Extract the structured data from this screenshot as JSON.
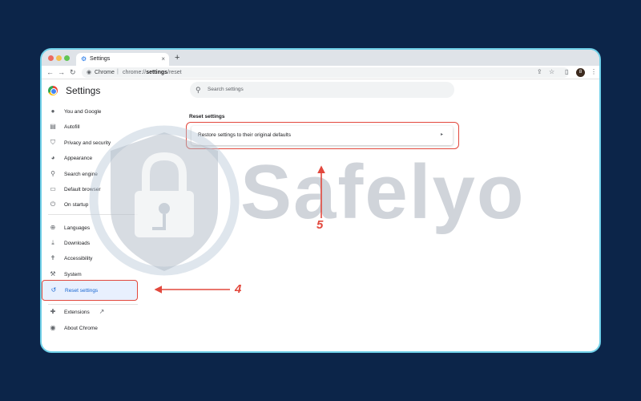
{
  "browser": {
    "tab_title": "Settings",
    "tab_close": "×",
    "new_tab": "+",
    "omnibox": {
      "brand": "Chrome",
      "separator": "|",
      "url_prefix": "chrome://",
      "url_bold": "settings",
      "url_suffix": "/reset"
    },
    "nav": {
      "back": "←",
      "forward": "→",
      "reload": "↻"
    },
    "toolbar_icons": {
      "share": "⇪",
      "bookmark": "☆",
      "side_panel": "▯",
      "menu": "⋮"
    },
    "profile_initial": "8"
  },
  "settings": {
    "title": "Settings",
    "search_placeholder": "Search settings",
    "sidebar": {
      "items": [
        {
          "label": "You and Google",
          "icon": "person-icon",
          "glyph": "●"
        },
        {
          "label": "Autofill",
          "icon": "clipboard-icon",
          "glyph": "▤"
        },
        {
          "label": "Privacy and security",
          "icon": "shield-icon",
          "glyph": "⛉"
        },
        {
          "label": "Appearance",
          "icon": "palette-icon",
          "glyph": "◕"
        },
        {
          "label": "Search engine",
          "icon": "search-icon",
          "glyph": "⚲"
        },
        {
          "label": "Default browser",
          "icon": "browser-icon",
          "glyph": "▭"
        },
        {
          "label": "On startup",
          "icon": "power-icon",
          "glyph": "⏻"
        },
        {
          "label": "Languages",
          "icon": "globe-icon",
          "glyph": "⊕"
        },
        {
          "label": "Downloads",
          "icon": "download-icon",
          "glyph": "⤓"
        },
        {
          "label": "Accessibility",
          "icon": "accessibility-icon",
          "glyph": "✝"
        },
        {
          "label": "System",
          "icon": "wrench-icon",
          "glyph": "⚒"
        },
        {
          "label": "Reset settings",
          "icon": "reset-icon",
          "glyph": "↺"
        },
        {
          "label": "Extensions",
          "icon": "puzzle-icon",
          "glyph": "✚"
        },
        {
          "label": "About Chrome",
          "icon": "chrome-icon",
          "glyph": "◉"
        }
      ],
      "extensions_external": "↗"
    },
    "main": {
      "section_title": "Reset settings",
      "restore_label": "Restore settings to their original defaults",
      "restore_arrow": "▸"
    }
  },
  "watermark": "Safelyo",
  "annotations": {
    "step_4": "4",
    "step_5": "5",
    "color": "#e2483d"
  },
  "colors": {
    "background": "#0c2549",
    "frame_border": "#6fd0e8",
    "active_item_bg": "#e8f0fe",
    "active_text": "#1967d2"
  }
}
